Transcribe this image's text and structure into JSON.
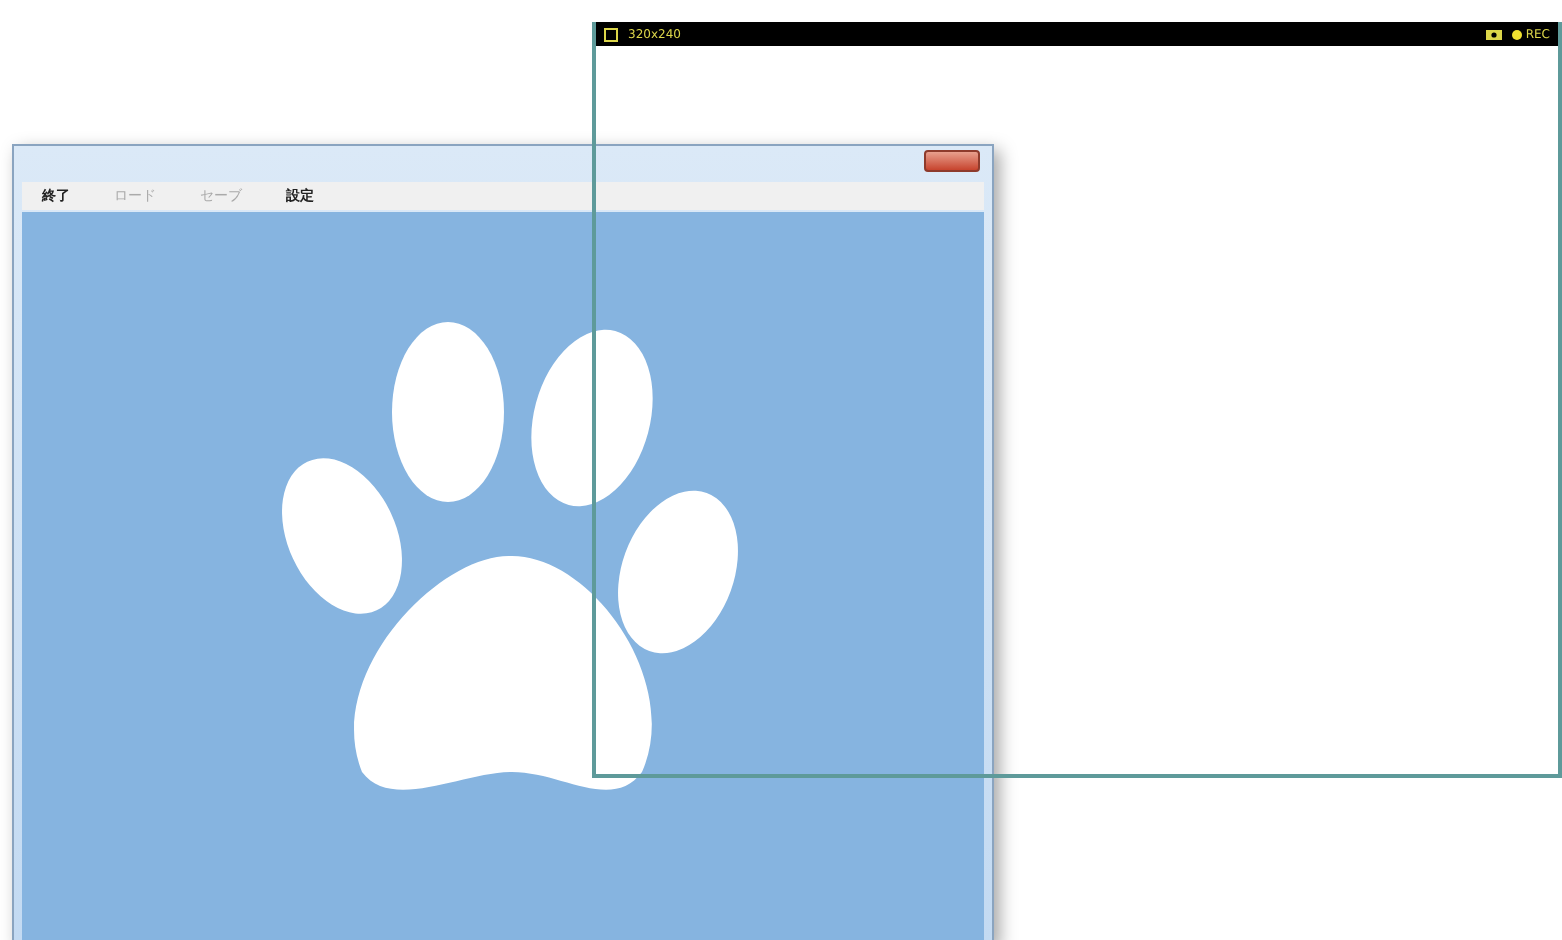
{
  "app_window": {
    "menu": [
      {
        "label": "終了",
        "disabled": false
      },
      {
        "label": "ロード",
        "disabled": true
      },
      {
        "label": "セーブ",
        "disabled": true
      },
      {
        "label": "設定",
        "disabled": false
      }
    ]
  },
  "capture_frame": {
    "size": "320x240",
    "recording": true,
    "rec_label": "REC"
  }
}
